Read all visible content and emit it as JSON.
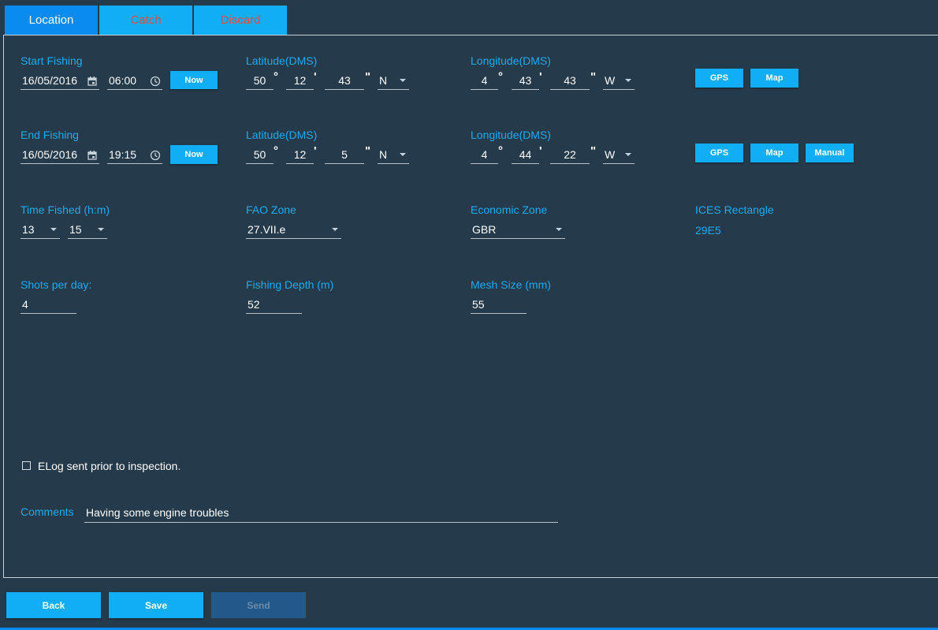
{
  "tabs": [
    {
      "label": "Location"
    },
    {
      "label": "Catch"
    },
    {
      "label": "Discard"
    }
  ],
  "start": {
    "label": "Start Fishing",
    "date": "16/05/2016",
    "time": "06:00",
    "now_label": "Now",
    "lat_label": "Latitude(DMS)",
    "lat": {
      "deg": "50",
      "min": "12",
      "sec": "43",
      "hem": "N"
    },
    "lon_label": "Longitude(DMS)",
    "lon": {
      "deg": "4",
      "min": "43",
      "sec": "43",
      "hem": "W"
    },
    "gps_label": "GPS",
    "map_label": "Map"
  },
  "end": {
    "label": "End Fishing",
    "date": "16/05/2016",
    "time": "19:15",
    "now_label": "Now",
    "lat_label": "Latitude(DMS)",
    "lat": {
      "deg": "50",
      "min": "12",
      "sec": "5",
      "hem": "N"
    },
    "lon_label": "Longitude(DMS)",
    "lon": {
      "deg": "4",
      "min": "44",
      "sec": "22",
      "hem": "W"
    },
    "gps_label": "GPS",
    "map_label": "Map",
    "manual_label": "Manual"
  },
  "units": {
    "deg": "°",
    "min": "'",
    "sec": "\""
  },
  "time_fished": {
    "label": "Time Fished (h:m)",
    "hours": "13",
    "minutes": "15"
  },
  "fao": {
    "label": "FAO Zone",
    "value": "27.VII.e"
  },
  "economic": {
    "label": "Economic Zone",
    "value": "GBR"
  },
  "ices": {
    "label": "ICES Rectangle",
    "value": "29E5"
  },
  "shots": {
    "label": "Shots per day:",
    "value": "4"
  },
  "depth": {
    "label": "Fishing Depth (m)",
    "value": "52"
  },
  "mesh": {
    "label": "Mesh Size (mm)",
    "value": "55"
  },
  "elog": {
    "label": "ELog sent prior to inspection.",
    "checked": false
  },
  "comments": {
    "label": "Comments",
    "value": "Having some engine troubles"
  },
  "actions": {
    "back": "Back",
    "save": "Save",
    "send": "Send"
  },
  "colors": {
    "accent": "#12aef5",
    "active_tab": "#0a8bef",
    "label": "#1eabf5",
    "inactive_tab_text": "#e84848",
    "background": "#253a4a"
  },
  "icons": [
    "calendar-icon",
    "clock-icon",
    "dropdown-caret-icon",
    "checkbox-icon"
  ]
}
